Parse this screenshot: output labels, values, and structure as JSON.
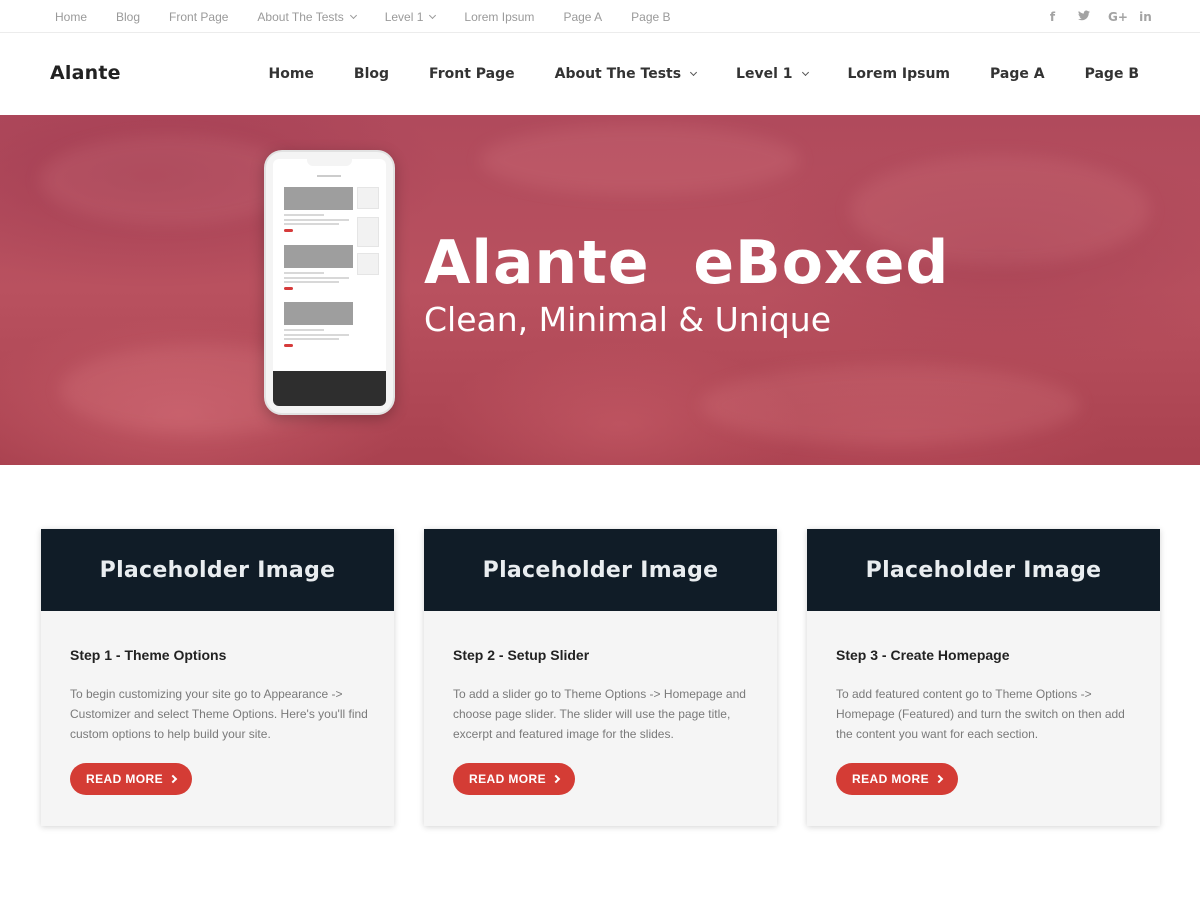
{
  "topbar": {
    "items": [
      {
        "label": "Home"
      },
      {
        "label": "Blog"
      },
      {
        "label": "Front Page"
      },
      {
        "label": "About The Tests",
        "has_dropdown": true
      },
      {
        "label": "Level 1",
        "has_dropdown": true
      },
      {
        "label": "Lorem Ipsum"
      },
      {
        "label": "Page A"
      },
      {
        "label": "Page B"
      }
    ],
    "social": [
      {
        "icon": "facebook-icon",
        "glyph": "f"
      },
      {
        "icon": "twitter-icon",
        "glyph": "t"
      },
      {
        "icon": "google-plus-icon",
        "glyph": "G+"
      },
      {
        "icon": "linkedin-icon",
        "glyph": "in"
      }
    ]
  },
  "header": {
    "logo": "Alante",
    "nav": [
      {
        "label": "Home"
      },
      {
        "label": "Blog"
      },
      {
        "label": "Front Page"
      },
      {
        "label": "About The Tests",
        "has_dropdown": true
      },
      {
        "label": "Level 1",
        "has_dropdown": true
      },
      {
        "label": "Lorem Ipsum"
      },
      {
        "label": "Page A"
      },
      {
        "label": "Page B"
      }
    ]
  },
  "hero": {
    "title": "Alante  eBoxed",
    "subtitle": "Clean, Minimal & Unique"
  },
  "cards": [
    {
      "image_label": "Placeholder Image",
      "title": "Step 1 - Theme Options",
      "text": "To begin customizing your site go to Appearance -> Customizer and select Theme Options. Here's you'll find custom options to help build your site.",
      "button": "READ MORE"
    },
    {
      "image_label": "Placeholder Image",
      "title": "Step 2 - Setup Slider",
      "text": "To add a slider go to Theme Options -> Homepage and choose page slider. The slider will use the page title, excerpt and featured image for the slides.",
      "button": "READ MORE"
    },
    {
      "image_label": "Placeholder Image",
      "title": "Step 3 - Create Homepage",
      "text": "To add featured content go to Theme Options -> Homepage (Featured) and turn the switch on then add the content you want for each section.",
      "button": "READ MORE"
    }
  ],
  "colors": {
    "accent": "#d43c35",
    "placeholder_bg": "#101c27",
    "hero_base": "#b04a5c"
  }
}
